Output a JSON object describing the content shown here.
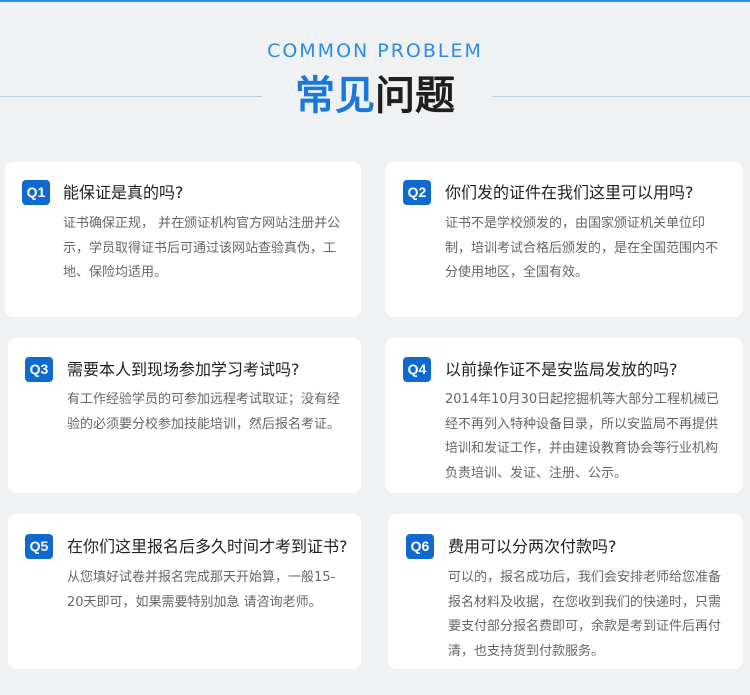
{
  "header": {
    "subtitle": "COMMON PROBLEM",
    "title_highlight": "常见",
    "title_rest": "问题"
  },
  "faq": [
    {
      "badge": "Q1",
      "question": "能保证是真的吗?",
      "answer": "证书确保正规， 并在颁证机构官方网站注册并公示，学员取得证书后可通过该网站查验真伪，工地、保险均适用。"
    },
    {
      "badge": "Q2",
      "question": "你们发的证件在我们这里可以用吗?",
      "answer": "证书不是学校颁发的，由国家颁证机关单位印制，培训考试合格后颁发的，是在全国范围内不分使用地区，全国有效。"
    },
    {
      "badge": "Q3",
      "question": "需要本人到现场参加学习考试吗?",
      "answer": "有工作经验学员的可参加远程考试取证；没有经验的必须要分校参加技能培训，然后报名考证。"
    },
    {
      "badge": "Q4",
      "question": "以前操作证不是安监局发放的吗?",
      "answer": "2014年10月30日起挖掘机等大部分工程机械已经不再列入特种设备目录，所以安监局不再提供培训和发证工作，并由建设教育协会等行业机构负责培训、发证、注册、公示。"
    },
    {
      "badge": "Q5",
      "question": "在你们这里报名后多久时间才考到证书?",
      "answer": "从您填好试卷并报名完成那天开始算，一般15-20天即可，如果需要特别加急 请咨询老师。"
    },
    {
      "badge": "Q6",
      "question": "费用可以分两次付款吗?",
      "answer": "可以的，报名成功后，我们会安排老师给您准备报名材料及收据，在您收到我们的快递时，只需要支付部分报名费即可，余款是考到证件后再付清，也支持货到付款服务。"
    }
  ]
}
